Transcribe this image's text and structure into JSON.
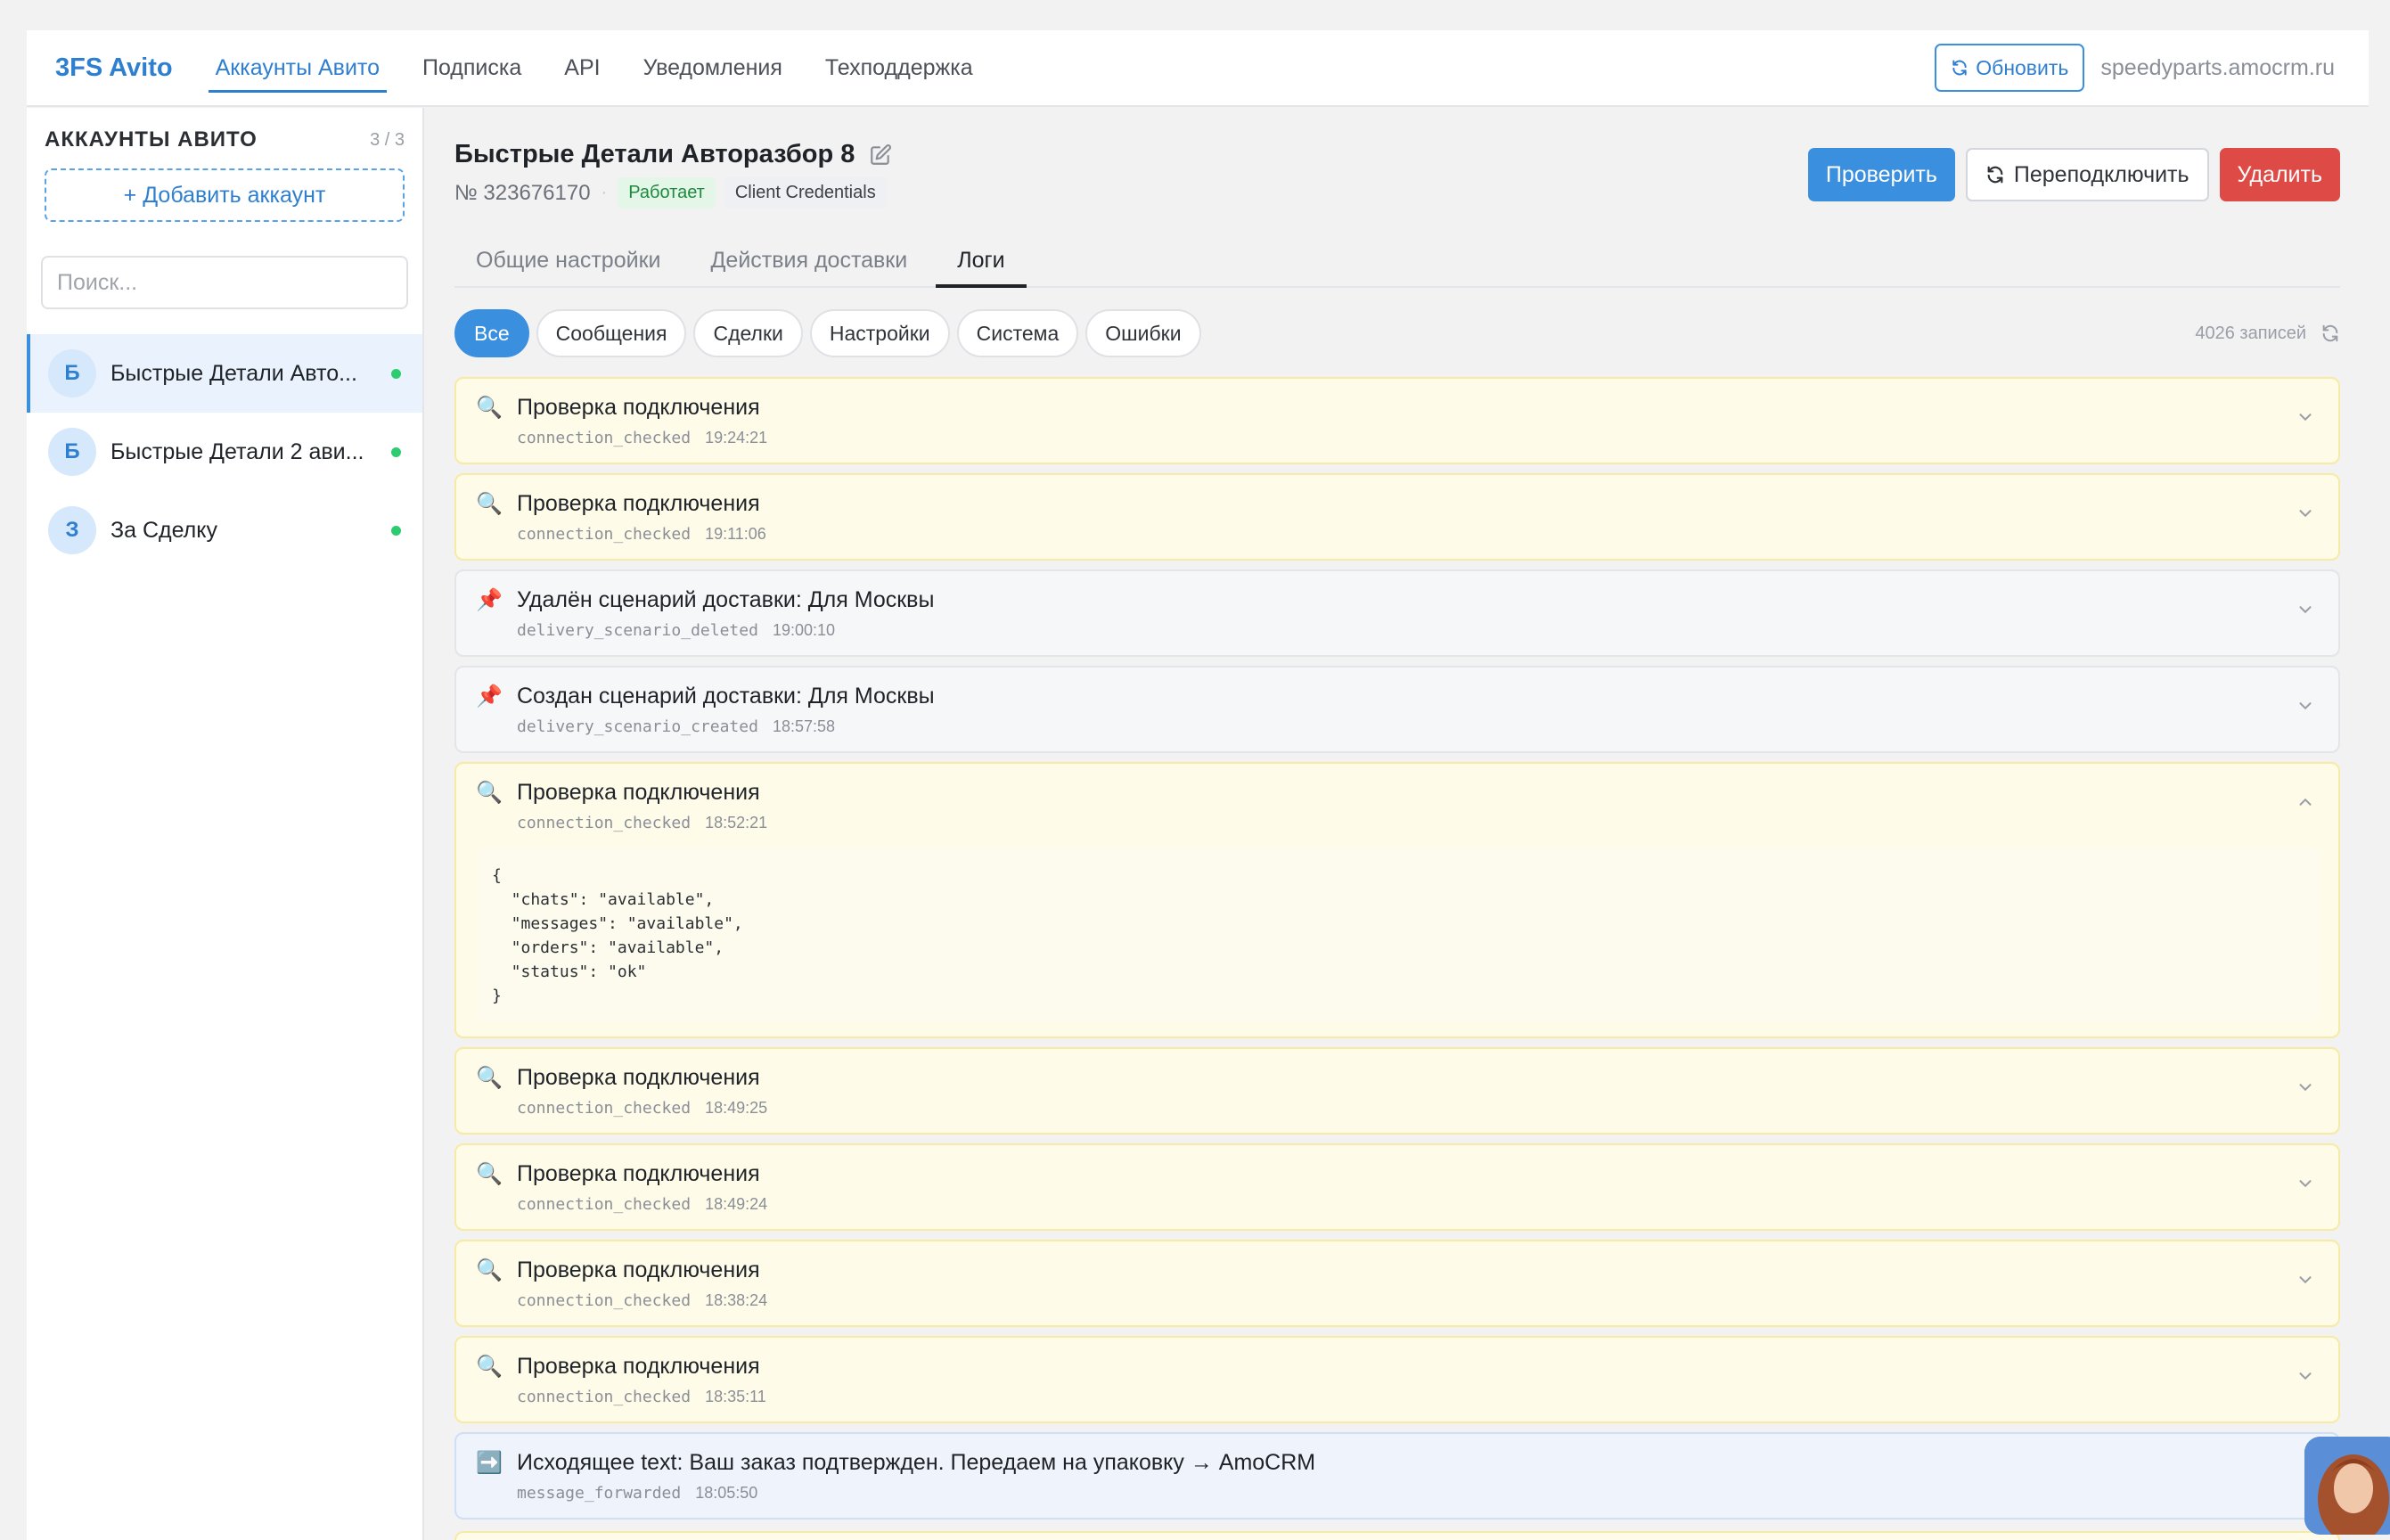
{
  "topbar": {
    "brand": "3FS Avito",
    "nav": [
      "Аккаунты Авито",
      "Подписка",
      "API",
      "Уведомления",
      "Техподдержка"
    ],
    "refresh_label": "Обновить",
    "domain": "speedyparts.amocrm.ru"
  },
  "sidebar": {
    "title": "АККАУНТЫ АВИТО",
    "count": "3 / 3",
    "add_label": "+ Добавить аккаунт",
    "search_placeholder": "Поиск...",
    "accounts": [
      {
        "initial": "Б",
        "name": "Быстрые Детали Авто...",
        "online": true
      },
      {
        "initial": "Б",
        "name": "Быстрые Детали 2 ави...",
        "online": true
      },
      {
        "initial": "З",
        "name": "За Сделку",
        "online": true
      }
    ]
  },
  "account": {
    "title": "Быстрые Детали Авторазбор 8",
    "number": "№ 323676170",
    "status": "Работает",
    "auth_type": "Client Credentials",
    "actions": {
      "check": "Проверить",
      "reconnect": "Переподключить",
      "delete": "Удалить"
    }
  },
  "tabs": [
    "Общие настройки",
    "Действия доставки",
    "Логи"
  ],
  "filters": [
    "Все",
    "Сообщения",
    "Сделки",
    "Настройки",
    "Система",
    "Ошибки"
  ],
  "records_label": "4026 записей",
  "logs": [
    {
      "icon": "magnifier-icon",
      "title": "Проверка подключения",
      "code": "connection_checked",
      "time": "19:24:21",
      "style": "yellow"
    },
    {
      "icon": "magnifier-icon",
      "title": "Проверка подключения",
      "code": "connection_checked",
      "time": "19:11:06",
      "style": "yellow"
    },
    {
      "icon": "pushpin-icon",
      "title": "Удалён сценарий доставки: Для Москвы",
      "code": "delivery_scenario_deleted",
      "time": "19:00:10",
      "style": "gray"
    },
    {
      "icon": "pushpin-icon",
      "title": "Создан сценарий доставки: Для Москвы",
      "code": "delivery_scenario_created",
      "time": "18:57:58",
      "style": "gray"
    },
    {
      "icon": "magnifier-icon",
      "title": "Проверка подключения",
      "code": "connection_checked",
      "time": "18:52:21",
      "style": "yellow",
      "expanded": true,
      "body": "{\n  \"chats\": \"available\",\n  \"messages\": \"available\",\n  \"orders\": \"available\",\n  \"status\": \"ok\"\n}"
    },
    {
      "icon": "magnifier-icon",
      "title": "Проверка подключения",
      "code": "connection_checked",
      "time": "18:49:25",
      "style": "yellow"
    },
    {
      "icon": "magnifier-icon",
      "title": "Проверка подключения",
      "code": "connection_checked",
      "time": "18:49:24",
      "style": "yellow"
    },
    {
      "icon": "magnifier-icon",
      "title": "Проверка подключения",
      "code": "connection_checked",
      "time": "18:38:24",
      "style": "yellow"
    },
    {
      "icon": "magnifier-icon",
      "title": "Проверка подключения",
      "code": "connection_checked",
      "time": "18:35:11",
      "style": "yellow"
    },
    {
      "icon": "right-arrow-icon",
      "title": "Исходящее text: Ваш заказ подтвержден. Передаем на упаковку → AmoCRM",
      "code": "message_forwarded",
      "time": "18:05:50",
      "style": "blue"
    }
  ],
  "colors": {
    "accent": "#3b8fdf",
    "danger": "#de4a45",
    "success": "#2ecc71"
  }
}
